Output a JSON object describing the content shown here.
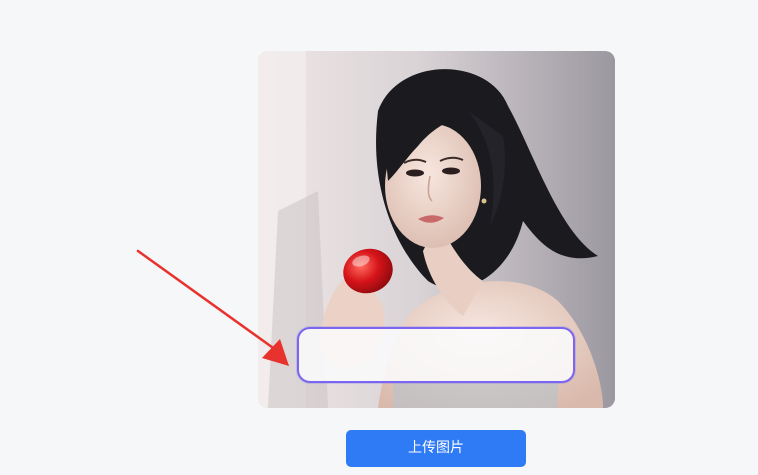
{
  "photo": {
    "subject": "portrait-with-red-product",
    "overlay_text": ""
  },
  "upload_button": {
    "label": "上传图片"
  },
  "colors": {
    "page_bg": "#f6f7f9",
    "button_bg": "#2f7bf6",
    "button_text": "#ffffff",
    "overlay_border": "#7a66f0",
    "arrow": "#e8322d"
  }
}
